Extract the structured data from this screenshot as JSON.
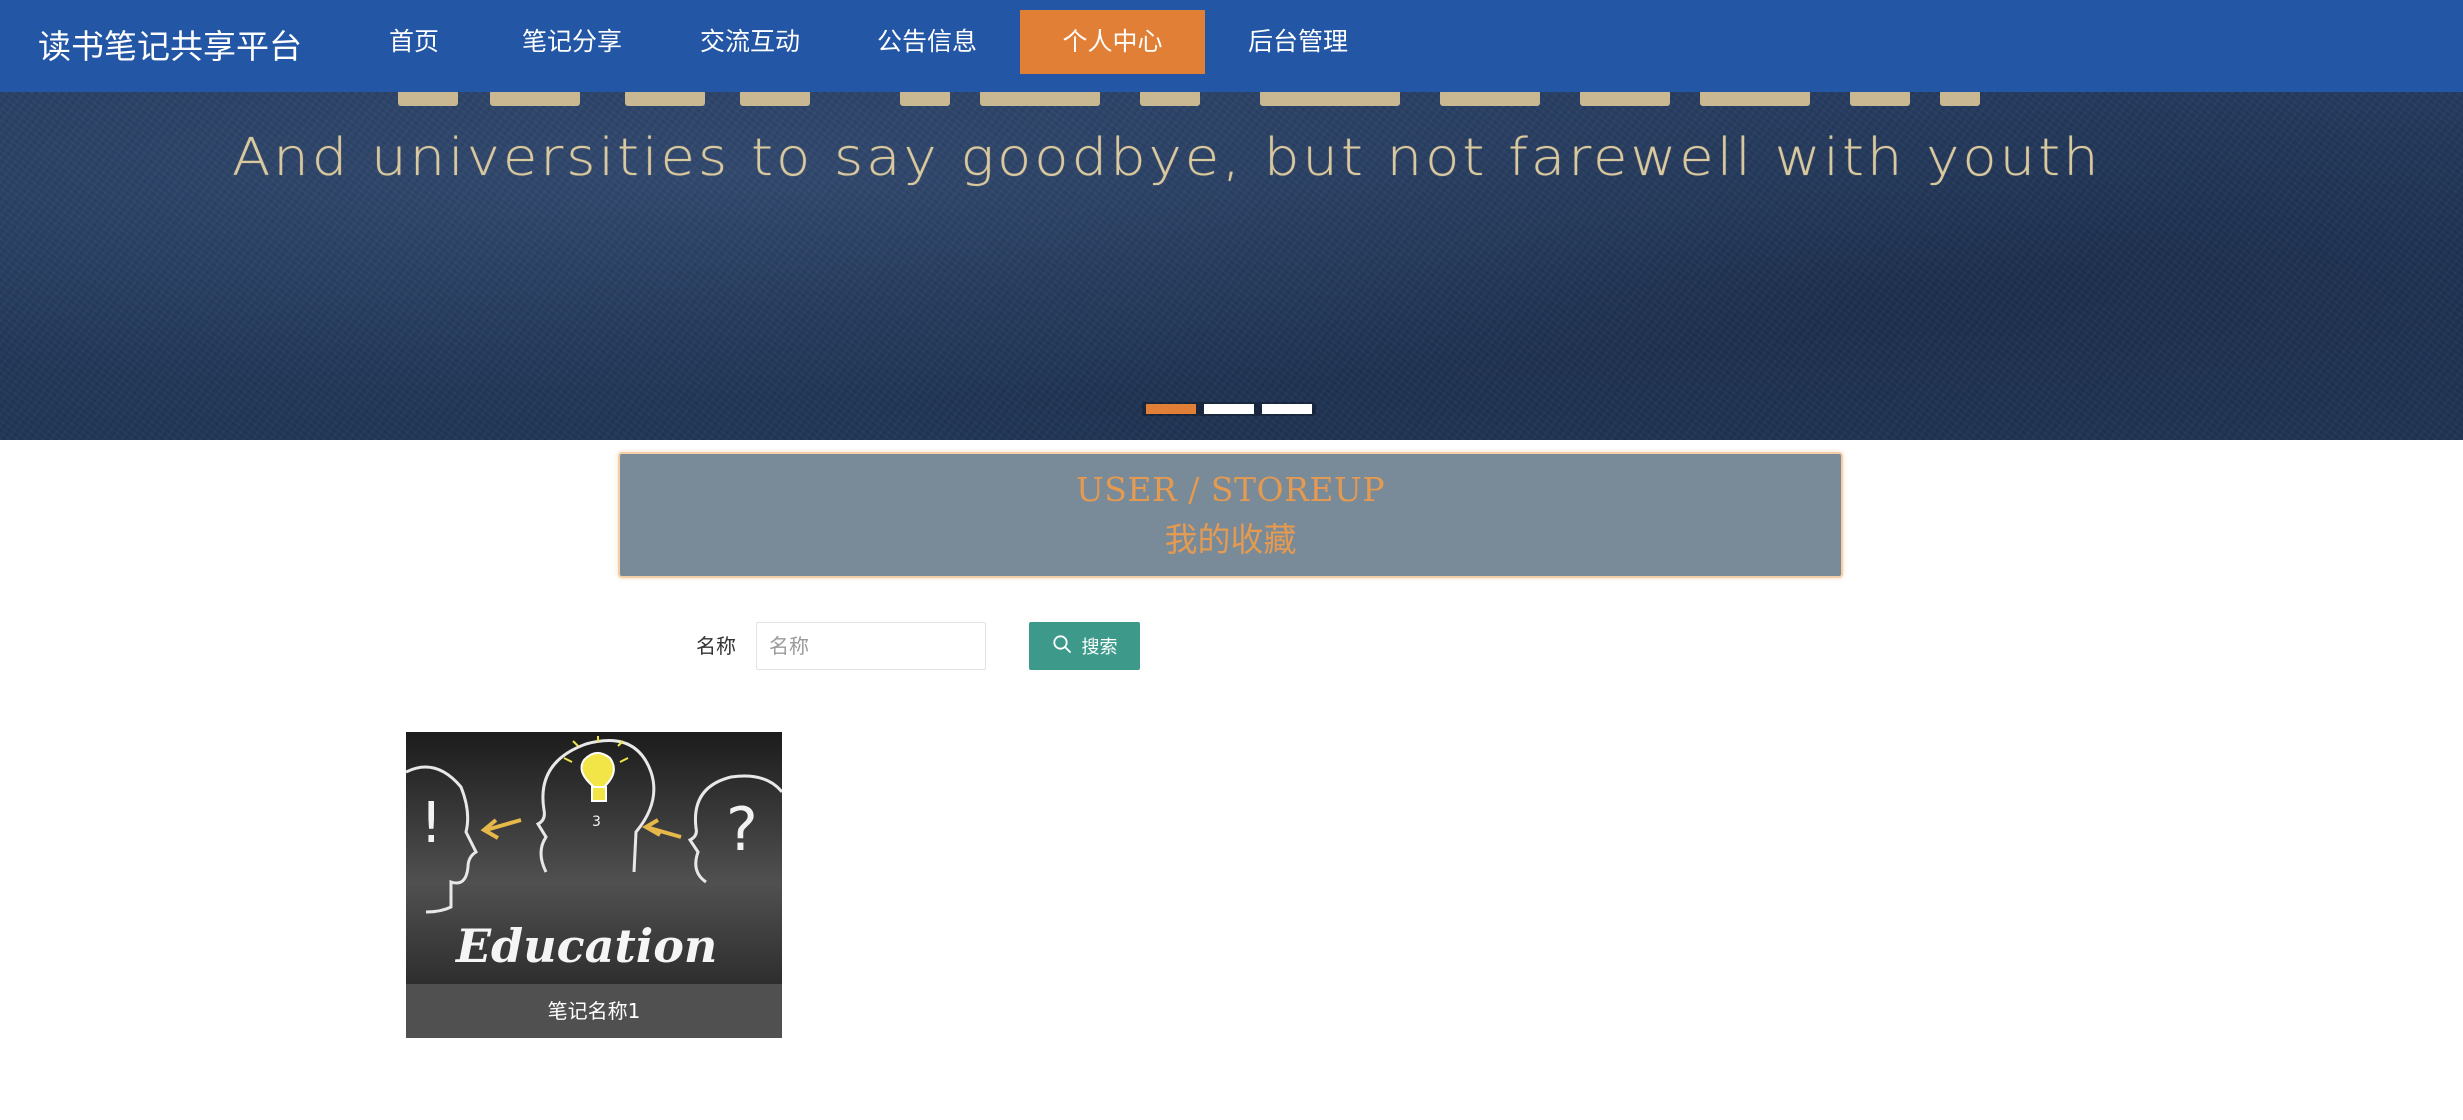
{
  "header": {
    "brand": "读书笔记共享平台",
    "nav": [
      {
        "label": "首页",
        "active": false
      },
      {
        "label": "笔记分享",
        "active": false
      },
      {
        "label": "交流互动",
        "active": false
      },
      {
        "label": "公告信息",
        "active": false
      },
      {
        "label": "个人中心",
        "active": true
      },
      {
        "label": "后台管理",
        "active": false
      }
    ]
  },
  "banner": {
    "tagline": "And universities to say goodbye, but not farewell with youth",
    "active_slide": 1,
    "slide_count": 3
  },
  "section": {
    "title_en": "USER / STOREUP",
    "title_cn": "我的收藏"
  },
  "search": {
    "label": "名称",
    "placeholder": "名称",
    "value": "",
    "button_label": "搜索"
  },
  "items": [
    {
      "name": "笔记名称1",
      "image_text": "Education"
    }
  ],
  "colors": {
    "nav_bg": "#2356a5",
    "accent": "#e07f35",
    "title_bg": "#798a98",
    "title_text": "#e49a51",
    "search_button": "#3d9a8b",
    "caption_bg": "#505050"
  }
}
